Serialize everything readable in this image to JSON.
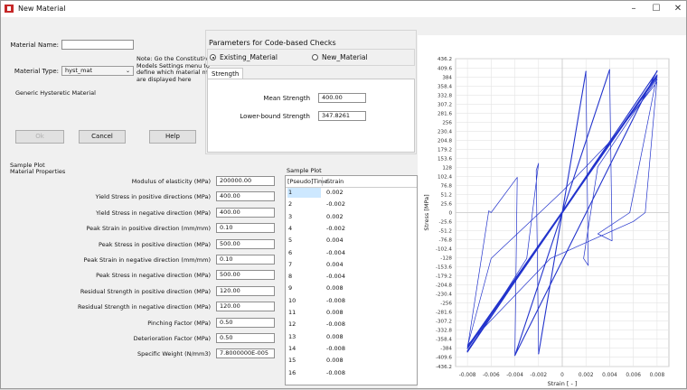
{
  "window": {
    "title": "New Material",
    "controls": [
      "–",
      "☐",
      "✕"
    ]
  },
  "form": {
    "material_name_label": "Material Name:",
    "material_name_value": "",
    "material_type_label": "Material Type:",
    "material_type_value": "hyst_mat",
    "note": [
      "Note: Go the Constitutive",
      "Models  Settings menu to",
      "define which material models",
      "are displayed here"
    ],
    "description": "Generic Hysteretic Material"
  },
  "buttons": {
    "ok": "Ok",
    "cancel": "Cancel",
    "help": "Help"
  },
  "code_checks": {
    "title": "Parameters for Code-based Checks",
    "option_existing": "Existing_Material",
    "option_new": "New_Material",
    "tab": "Strength",
    "mean_label": "Mean Strength",
    "mean_value": "400.00",
    "lower_label": "Lower-bound Strength",
    "lower_value": "347.8261"
  },
  "sample_plot_header": "Sample Plot",
  "properties_header": "Material Properties",
  "properties": [
    {
      "label": "Modulus of elasticity (MPa)",
      "value": "200000.00"
    },
    {
      "label": "Yield Stress in positive directions (MPa)",
      "value": "400.00"
    },
    {
      "label": "Yield Stress in negative direction (MPa)",
      "value": "400.00"
    },
    {
      "label": "Peak Strain in positive direction (mm/mm)",
      "value": "0.10"
    },
    {
      "label": "Peak Stress in positive direction (MPa)",
      "value": "500.00"
    },
    {
      "label": "Peak Strain in negative direction (mm/mm)",
      "value": "0.10"
    },
    {
      "label": "Peak Stress in negative direction (MPa)",
      "value": "500.00"
    },
    {
      "label": "Residual Strength in positive direction (MPa)",
      "value": "120.00"
    },
    {
      "label": "Residual Strength in negative direction (MPa)",
      "value": "120.00"
    },
    {
      "label": "Pinching Factor (MPa)",
      "value": "0.50"
    },
    {
      "label": "Deterioration Factor (MPa)",
      "value": "0.50"
    },
    {
      "label": "Specific Weight (N/mm3)",
      "value": "7.8000000E-005"
    }
  ],
  "sample_table": {
    "title": "Sample Plot",
    "headers": [
      "[Pseudo]Time",
      "Strain"
    ],
    "rows": [
      [
        "1",
        "0.002"
      ],
      [
        "2",
        "-0.002"
      ],
      [
        "3",
        "0.002"
      ],
      [
        "4",
        "-0.002"
      ],
      [
        "5",
        "0.004"
      ],
      [
        "6",
        "-0.004"
      ],
      [
        "7",
        "0.004"
      ],
      [
        "8",
        "-0.004"
      ],
      [
        "9",
        "0.008"
      ],
      [
        "10",
        "-0.008"
      ],
      [
        "11",
        "0.008"
      ],
      [
        "12",
        "-0.008"
      ],
      [
        "13",
        "0.008"
      ],
      [
        "14",
        "-0.008"
      ],
      [
        "15",
        "0.008"
      ],
      [
        "16",
        "-0.008"
      ]
    ]
  },
  "chart_data": {
    "type": "line",
    "xlabel": "Strain [ - ]",
    "ylabel": "Stress [MPa]",
    "xlim": [
      -0.009,
      0.009
    ],
    "ylim": [
      -436.2,
      436.2
    ],
    "xticks": [
      "-0.008",
      "-0.006",
      "-0.004",
      "-0.002",
      "0",
      "0.002",
      "0.004",
      "0.006",
      "0.008"
    ],
    "yticks": [
      "436.2",
      "409.6",
      "384",
      "358.4",
      "332.8",
      "307.2",
      "281.6",
      "256",
      "230.4",
      "204.8",
      "179.2",
      "153.6",
      "128",
      "102.4",
      "76.8",
      "51.2",
      "25.6",
      "0",
      "-25.6",
      "-51.2",
      "-76.8",
      "-102.4",
      "-128",
      "-153.6",
      "-179.2",
      "-204.8",
      "-230.4",
      "-256",
      "-281.6",
      "-307.2",
      "-332.8",
      "-358.4",
      "-384",
      "-409.6",
      "-436.2"
    ],
    "grid": true,
    "color": "#2233cc",
    "series": [
      {
        "x": [
          0,
          0.002,
          0,
          -0.002,
          0,
          0.004,
          0.004,
          -0.004,
          -0.004,
          0.008,
          0.008,
          -0.008,
          -0.008,
          0.008,
          -0.008,
          0.008,
          -0.008
        ],
        "y": [
          0,
          400,
          0,
          -400,
          0,
          405,
          405,
          -405,
          -405,
          402,
          400,
          -395,
          -392,
          390,
          -385,
          385,
          -380
        ]
      },
      {
        "x": [
          0.002,
          0.0022,
          0.0018,
          0.003,
          0.008
        ],
        "y": [
          400,
          -150,
          -130,
          130,
          380
        ]
      },
      {
        "x": [
          -0.002,
          -0.0022,
          -0.002,
          -0.003,
          -0.008
        ],
        "y": [
          -400,
          120,
          140,
          -130,
          -395
        ]
      },
      {
        "x": [
          0.004,
          0.0042,
          0.003,
          0.0057,
          0.008
        ],
        "y": [
          405,
          -80,
          -60,
          0,
          390
        ]
      },
      {
        "x": [
          -0.004,
          -0.0038,
          -0.006,
          -0.0062,
          -0.008
        ],
        "y": [
          -405,
          100,
          0,
          5,
          -385
        ]
      },
      {
        "x": [
          0.008,
          0.007,
          0.006,
          -0.001,
          -0.008
        ],
        "y": [
          380,
          0,
          -25,
          -130,
          -375
        ]
      },
      {
        "x": [
          -0.008,
          -0.006,
          0,
          0.004,
          0.008
        ],
        "y": [
          -380,
          -130,
          60,
          200,
          370
        ]
      }
    ]
  }
}
